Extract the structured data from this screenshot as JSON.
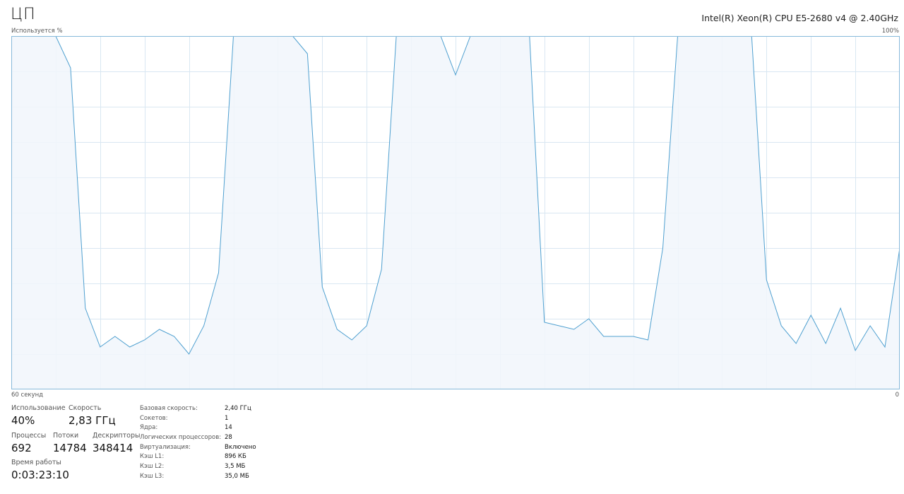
{
  "header": {
    "title": "ЦП",
    "cpu_model": "Intel(R) Xeon(R) CPU E5-2680 v4 @ 2.40GHz",
    "y_axis_label": "Используется %",
    "y_max_label": "100%",
    "x_left_label": "60 секунд",
    "x_right_label": "0"
  },
  "colors": {
    "line": "#4fa0d0",
    "fill": "#f1f6fb",
    "grid": "#d9e7f2",
    "border": "#87b9da"
  },
  "chart_data": {
    "type": "area",
    "xlabel": "",
    "ylabel": "Используется %",
    "xlim": [
      60,
      0
    ],
    "ylim": [
      0,
      100
    ],
    "grid": true,
    "x_seconds_ago": [
      60,
      59,
      58,
      57,
      56,
      55,
      54,
      53,
      52,
      51,
      50,
      49,
      48,
      47,
      46,
      45,
      44,
      43,
      42,
      41,
      40,
      39,
      38,
      37,
      36,
      35,
      34,
      33,
      32,
      31,
      30,
      29,
      28,
      27,
      26,
      25,
      24,
      23,
      22,
      21,
      20,
      19,
      18,
      17,
      16,
      15,
      14,
      13,
      12,
      11,
      10,
      9,
      8,
      7,
      6,
      5,
      4,
      3,
      2,
      1,
      0
    ],
    "values": [
      100,
      100,
      100,
      100,
      91,
      23,
      12,
      15,
      12,
      14,
      17,
      15,
      10,
      18,
      33,
      100,
      100,
      100,
      100,
      100,
      95,
      29,
      17,
      14,
      18,
      34,
      100,
      100,
      100,
      100,
      89,
      100,
      100,
      100,
      100,
      100,
      19,
      18,
      17,
      20,
      15,
      15,
      15,
      14,
      40,
      100,
      100,
      100,
      100,
      100,
      100,
      31,
      18,
      13,
      21,
      13,
      23,
      11,
      18,
      12,
      40
    ]
  },
  "stats": {
    "utilization": {
      "label": "Использование",
      "value": "40%"
    },
    "speed": {
      "label": "Скорость",
      "value": "2,83 ГГц"
    },
    "processes": {
      "label": "Процессы",
      "value": "692"
    },
    "threads": {
      "label": "Потоки",
      "value": "14784"
    },
    "handles": {
      "label": "Дескрипторы",
      "value": "348414"
    },
    "uptime": {
      "label": "Время работы",
      "value": "0:03:23:10"
    }
  },
  "details": [
    {
      "label": "Базовая скорость:",
      "value": "2,40 ГГц"
    },
    {
      "label": "Сокетов:",
      "value": "1"
    },
    {
      "label": "Ядра:",
      "value": "14"
    },
    {
      "label": "Логических процессоров:",
      "value": "28"
    },
    {
      "label": "Виртуализация:",
      "value": "Включено"
    },
    {
      "label": "Кэш L1:",
      "value": "896 КБ"
    },
    {
      "label": "Кэш L2:",
      "value": "3,5 МБ"
    },
    {
      "label": "Кэш L3:",
      "value": "35,0 МБ"
    }
  ]
}
